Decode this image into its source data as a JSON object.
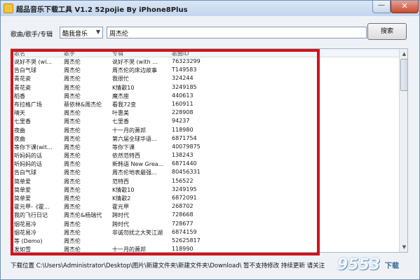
{
  "window": {
    "title": "超品音乐下载工具 V1.2 52pojie By iPhone8Plus",
    "close_label": "✕",
    "minimize_label": "—"
  },
  "search": {
    "label": "歌曲/歌手/专辑",
    "source_value": "酷我音乐",
    "query_value": "周杰伦",
    "button_label": "搜索"
  },
  "list": {
    "columns": [
      "歌名",
      "歌手",
      "专辑",
      "歌曲ID"
    ],
    "rows": [
      [
        "说好不哭 (wi...",
        "周杰伦",
        "说好不哭 (with ...",
        "76323299"
      ],
      [
        "告白气球",
        "周杰伦",
        "周杰伦的床边故事",
        "T149583"
      ],
      [
        "青花瓷",
        "周杰伦",
        "我很忙",
        "324244"
      ],
      [
        "青花瓷",
        "周杰伦",
        "K情歌10",
        "3249185"
      ],
      [
        "稻香",
        "周杰伦",
        "魔杰座",
        "440613"
      ],
      [
        "布拉格广场",
        "蔡依林&周杰伦",
        "看我72变",
        "160911"
      ],
      [
        "晴天",
        "周杰伦",
        "叶惠美",
        "228908"
      ],
      [
        "七里香",
        "周杰伦",
        "七里香",
        "94237"
      ],
      [
        "夜曲",
        "周杰伦",
        "十一月的萧邦",
        "118980"
      ],
      [
        "夜曲",
        "周杰伦",
        "第六届全球华语...",
        "6871754"
      ],
      [
        "等你下课(wit...",
        "周杰伦",
        "等你下课",
        "40079875"
      ],
      [
        "听妈妈的话",
        "周杰伦",
        "依然范特西",
        "138243"
      ],
      [
        "听妈妈的话",
        "周杰伦",
        "新韩语 New Grea...",
        "6871440"
      ],
      [
        "告白气球",
        "周杰伦",
        "周杰伦地表最强...",
        "80456331"
      ],
      [
        "简单爱",
        "周杰伦",
        "范特西",
        "156522"
      ],
      [
        "简单爱",
        "周杰伦",
        "K情歌10",
        "3249195"
      ],
      [
        "简单爱",
        "周杰伦",
        "K情歌2",
        "6872091"
      ],
      [
        "霍元甲-《霍...",
        "周杰伦",
        "霍元甲",
        "268702"
      ],
      [
        "我的飞行日记",
        "周杰伦&杨瑞代",
        "跨时代",
        "728668"
      ],
      [
        "烟花易冷",
        "周杰伦",
        "跨时代",
        "728677"
      ],
      [
        "烟花易冷",
        "周杰伦",
        "非诚勿扰之大笑江湖",
        "6874159"
      ],
      [
        "等 (Demo)",
        "周杰伦",
        "",
        "52625817"
      ],
      [
        "发如雪",
        "周杰伦",
        "十一月的萧邦",
        "118990"
      ],
      [
        "给我一首歌的...",
        "周杰伦",
        "魔杰座",
        "440614"
      ],
      [
        "反阿婆",
        "周杰伦",
        "叶惠美",
        "79479"
      ]
    ]
  },
  "status": {
    "text": "下载位置 C:\\Users\\Administrator\\Desktop\\图片\\新建文件夹\\新建文件夹\\Download\\ 暂不支持修改 持续更新 请关注"
  },
  "watermark": {
    "text": "9553",
    "sub": "下载"
  },
  "colors": {
    "highlight": "#d0141a",
    "titlebar": "#c3d6ee",
    "close": "#c74b34"
  }
}
